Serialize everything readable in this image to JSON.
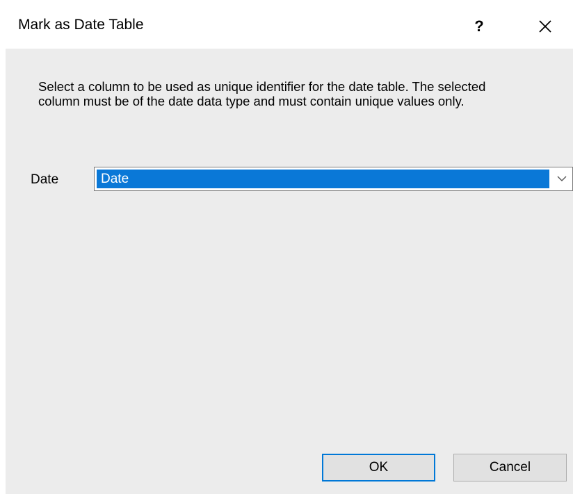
{
  "dialog": {
    "title": "Mark as Date Table",
    "help_glyph": "?",
    "close_icon": "close-icon"
  },
  "content": {
    "description": "Select a column to be used as unique identifier for the date table. The selected column must be of the date data type and must contain unique values only.",
    "date_label": "Date",
    "date_column": {
      "selected_value": "Date",
      "selection_color": "#0a78d7",
      "dropdown_icon": "chevron-down-icon"
    }
  },
  "buttons": {
    "ok_label": "OK",
    "cancel_label": "Cancel",
    "default_border_color": "#0078d7"
  },
  "colors": {
    "body_background": "#ececec",
    "button_background": "#e1e1e1"
  }
}
